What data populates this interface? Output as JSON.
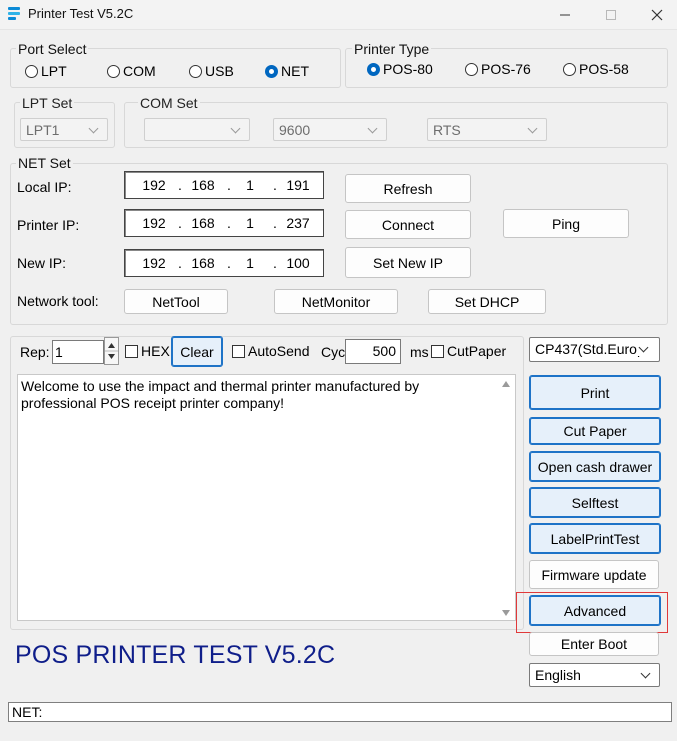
{
  "window": {
    "title": "Printer Test V5.2C"
  },
  "port_select": {
    "label": "Port Select",
    "options": [
      {
        "label": "LPT",
        "selected": false
      },
      {
        "label": "COM",
        "selected": false
      },
      {
        "label": "USB",
        "selected": false
      },
      {
        "label": "NET",
        "selected": true
      }
    ]
  },
  "printer_type": {
    "label": "Printer Type",
    "options": [
      {
        "label": "POS-80",
        "selected": true
      },
      {
        "label": "POS-76",
        "selected": false
      },
      {
        "label": "POS-58",
        "selected": false
      }
    ]
  },
  "lpt_set": {
    "label": "LPT Set",
    "port": "LPT1"
  },
  "com_set": {
    "label": "COM Set",
    "port": "",
    "baud": "9600",
    "flow": "RTS"
  },
  "net_set": {
    "label": "NET Set",
    "local_ip": {
      "label": "Local IP:",
      "octets": [
        "192",
        "168",
        "1",
        "191"
      ]
    },
    "printer_ip": {
      "label": "Printer IP:",
      "octets": [
        "192",
        "168",
        "1",
        "237"
      ]
    },
    "new_ip": {
      "label": "New IP:",
      "octets": [
        "192",
        "168",
        "1",
        "100"
      ]
    },
    "dot": ".",
    "refresh_label": "Refresh",
    "connect_label": "Connect",
    "ping_label": "Ping",
    "set_new_ip_label": "Set New IP",
    "network_tool_label": "Network tool:",
    "nettool_label": "NetTool",
    "netmonitor_label": "NetMonitor",
    "set_dhcp_label": "Set DHCP"
  },
  "send": {
    "rep_label": "Rep:",
    "rep_value": "1",
    "hex_label": "HEX",
    "clear_label": "Clear",
    "autosend_label": "AutoSend",
    "cyc_label": "Cyc",
    "cyc_value": "500",
    "ms_label": "ms",
    "cutpaper_label": "CutPaper",
    "codepage": "CP437(Std.Europe",
    "message": "Welcome to use the impact and thermal printer manufactured by professional POS receipt printer company!"
  },
  "actions": {
    "print": "Print",
    "cut_paper": "Cut Paper",
    "open_cash_drawer": "Open cash drawer",
    "selftest": "Selftest",
    "label_print_test": "LabelPrintTest",
    "firmware_update": "Firmware update",
    "advanced": "Advanced",
    "enter_boot": "Enter Boot",
    "language": "English"
  },
  "banner": "POS PRINTER TEST V5.2C",
  "status": "NET:",
  "colors": {
    "accent": "#1e73c7",
    "banner": "#0f1e8a",
    "highlight": "#e0393a"
  }
}
